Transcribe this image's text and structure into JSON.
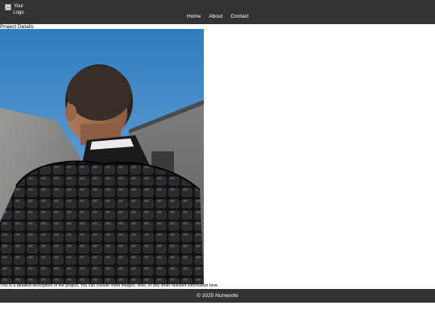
{
  "header": {
    "logo_text_line1": "Your",
    "logo_text_line2": "Logo",
    "nav": [
      "Home",
      "About",
      "Contact"
    ]
  },
  "main": {
    "title": "Project Details",
    "description": "This is a detailed description of the project. You can include more images, links, or any other relevant information here."
  },
  "footer": {
    "text": "© 2025 Numerote"
  },
  "colors": {
    "header_bg": "#333333",
    "footer_bg": "#333333",
    "text_light": "#ffffff"
  }
}
